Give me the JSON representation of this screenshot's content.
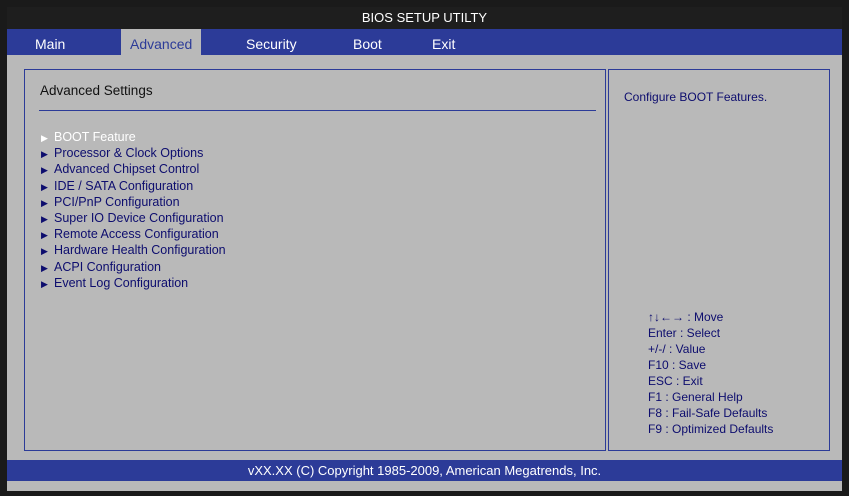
{
  "title": "BIOS SETUP UTILTY",
  "tabs": [
    {
      "label": "Main"
    },
    {
      "label": "Advanced"
    },
    {
      "label": "Security"
    },
    {
      "label": "Boot"
    },
    {
      "label": "Exit"
    }
  ],
  "active_tab": "Advanced",
  "section": {
    "title": "Advanced Settings",
    "items": [
      {
        "label": "BOOT Feature",
        "arrow": "▶",
        "selected": true
      },
      {
        "label": "Processor & Clock Options",
        "arrow": "▶"
      },
      {
        "label": "Advanced Chipset Control",
        "arrow": "▶"
      },
      {
        "label": "IDE / SATA Configuration",
        "arrow": "▶"
      },
      {
        "label": "PCI/PnP Configuration",
        "arrow": "▶"
      },
      {
        "label": "Super IO Device Configuration",
        "arrow": "▶"
      },
      {
        "label": "Remote Access Configuration",
        "arrow": "▶"
      },
      {
        "label": "Hardware Health Configuration",
        "arrow": "▶"
      },
      {
        "label": "ACPI Configuration",
        "arrow": "▶"
      },
      {
        "label": "Event Log Configuration",
        "arrow": "▶"
      }
    ]
  },
  "help": {
    "text": "Configure BOOT Features.",
    "keys": [
      "↑↓←→ : Move",
      "Enter : Select",
      "+/-/ : Value",
      "F10 : Save",
      "ESC : Exit",
      "F1 : General Help",
      "F8 : Fail-Safe Defaults",
      "F9 : Optimized Defaults"
    ]
  },
  "footer": "vXX.XX (C) Copyright 1985-2009, American Megatrends, Inc.",
  "colors": {
    "accent_blue": "#2c3b98",
    "panel_gray": "#b9b9b9",
    "text_dark_blue": "#0d0d6e",
    "selected_text": "#ffffff"
  }
}
